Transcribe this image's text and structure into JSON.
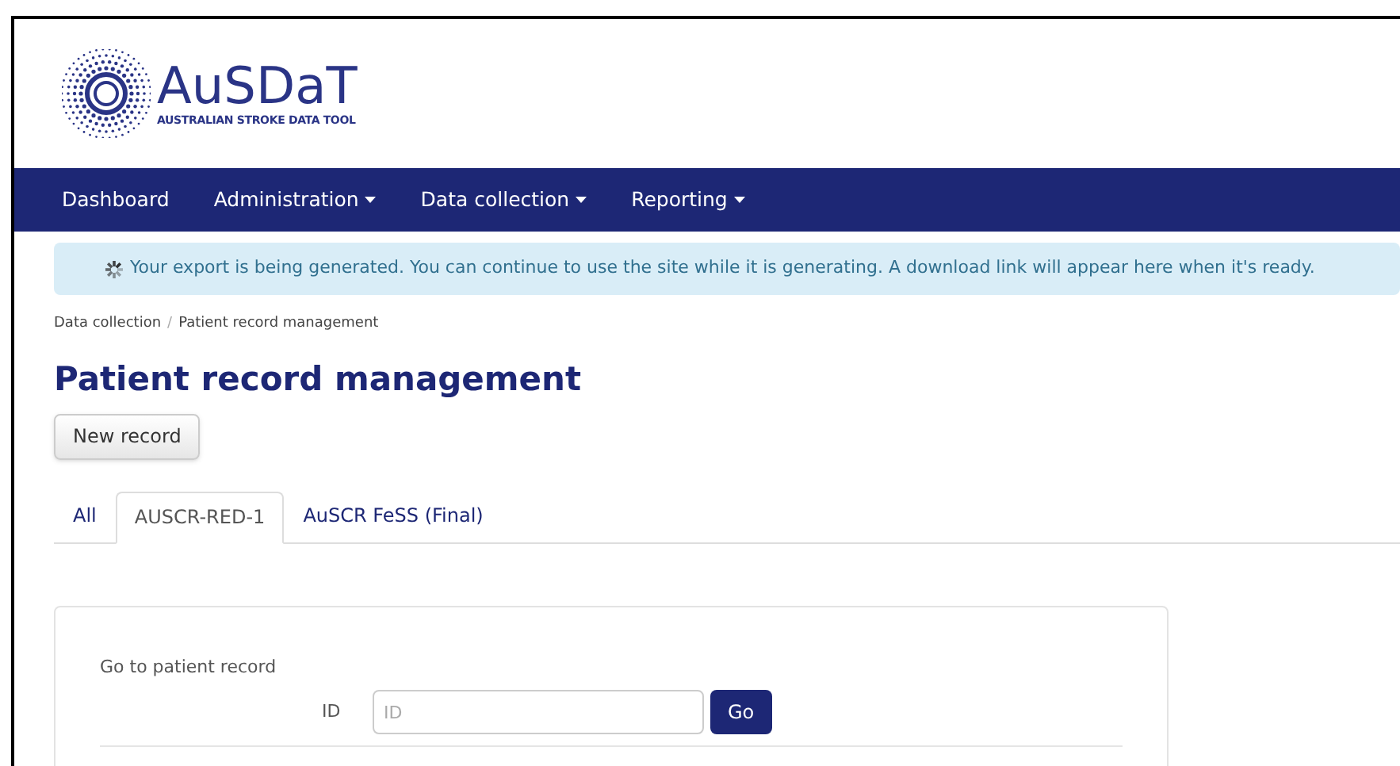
{
  "logo": {
    "name": "AuSDaT",
    "tagline": "AUSTRALIAN STROKE DATA TOOL"
  },
  "nav": [
    {
      "label": "Dashboard",
      "dropdown": false
    },
    {
      "label": "Administration",
      "dropdown": true
    },
    {
      "label": "Data collection",
      "dropdown": true
    },
    {
      "label": "Reporting",
      "dropdown": true
    }
  ],
  "alert": "Your export is being generated. You can continue to use the site while it is generating. A download link will appear here when it's ready.",
  "breadcrumb": [
    "Data collection",
    "Patient record management"
  ],
  "breadcrumb_separator": "/",
  "title": "Patient record management",
  "new_button": "New record",
  "tabs": [
    {
      "label": "All",
      "selected": false
    },
    {
      "label": "AUSCR-RED-1",
      "selected": true
    },
    {
      "label": "AuSCR FeSS (Final)",
      "selected": false
    }
  ],
  "goto": {
    "heading": "Go to patient record",
    "label": "ID",
    "placeholder": "ID",
    "button": "Go"
  }
}
